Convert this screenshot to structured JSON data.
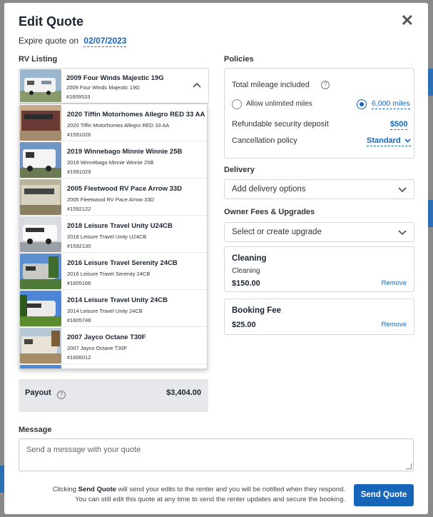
{
  "modal": {
    "title": "Edit Quote",
    "close_glyph": "✕",
    "expire_label": "Expire quote on",
    "expire_date": "02/07/2023"
  },
  "rv_listing": {
    "label": "RV Listing",
    "selected": {
      "name": "2009 Four Winds Majestic 19G",
      "sub": "2009 Four Winds Majestic 19G",
      "id": "#1609533"
    },
    "options": [
      {
        "name": "2020 Tiffin Motorhomes Allegro RED 33 AA",
        "sub": "2020 Tiffin Motorhomes Allegro RED 33 AA",
        "id": "#1591026"
      },
      {
        "name": "2019 Winnebago Minnie Winnie 25B",
        "sub": "2019 Winnebago Minnie Winnie 25B",
        "id": "#1591029"
      },
      {
        "name": "2005 Fleetwood RV Pace Arrow 33D",
        "sub": "2005 Fleetwood RV Pace Arrow 33D",
        "id": "#1592122"
      },
      {
        "name": "2018 Leisure Travel Unity U24CB",
        "sub": "2018 Leisure Travel Unity U24CB",
        "id": "#1592130"
      },
      {
        "name": "2016 Leisure Travel Serenity 24CB",
        "sub": "2016 Leisure Travel Serenity 24CB",
        "id": "#1605166"
      },
      {
        "name": "2014 Leisure Travel Unity 24CB",
        "sub": "2014 Leisure Travel Unity 24CB",
        "id": "#1605748"
      },
      {
        "name": "2007 Jayco Octane T30F",
        "sub": "2007 Jayco Octane T30F",
        "id": "#1606012"
      }
    ]
  },
  "payout": {
    "label": "Payout",
    "amount": "$3,404.00"
  },
  "policies": {
    "label": "Policies",
    "mileage_label": "Total mileage included",
    "unlimited_label": "Allow unlimited miles",
    "miles_value": "6,000 miles",
    "deposit_label": "Refundable security deposit",
    "deposit_value": "$500",
    "cancellation_label": "Cancellation policy",
    "cancellation_value": "Standard"
  },
  "delivery": {
    "label": "Delivery",
    "placeholder": "Add delivery options"
  },
  "fees": {
    "label": "Owner Fees & Upgrades",
    "placeholder": "Select or create upgrade",
    "items": [
      {
        "name": "Cleaning",
        "sub": "Cleaning",
        "price": "$150.00",
        "remove": "Remove"
      },
      {
        "name": "Booking Fee",
        "price": "$25.00",
        "remove": "Remove"
      }
    ]
  },
  "message": {
    "label": "Message",
    "placeholder": "Send a message with your quote"
  },
  "footer": {
    "line1_pre": "Clicking",
    "line1_bold": "Send Quote",
    "line1_post": "will send your edits to the renter and you will be notified when they respond.",
    "line2": "You can still edit this quote at any time to send the renter updates and secure the booking.",
    "send_label": "Send Quote"
  },
  "colors": {
    "accent": "#1665b8",
    "text": "#1b2430",
    "border": "#d3d6da"
  },
  "icons": [
    "close-icon",
    "chevron-up-icon",
    "chevron-down-icon",
    "help-icon",
    "radio-icon",
    "resize-handle-icon"
  ]
}
